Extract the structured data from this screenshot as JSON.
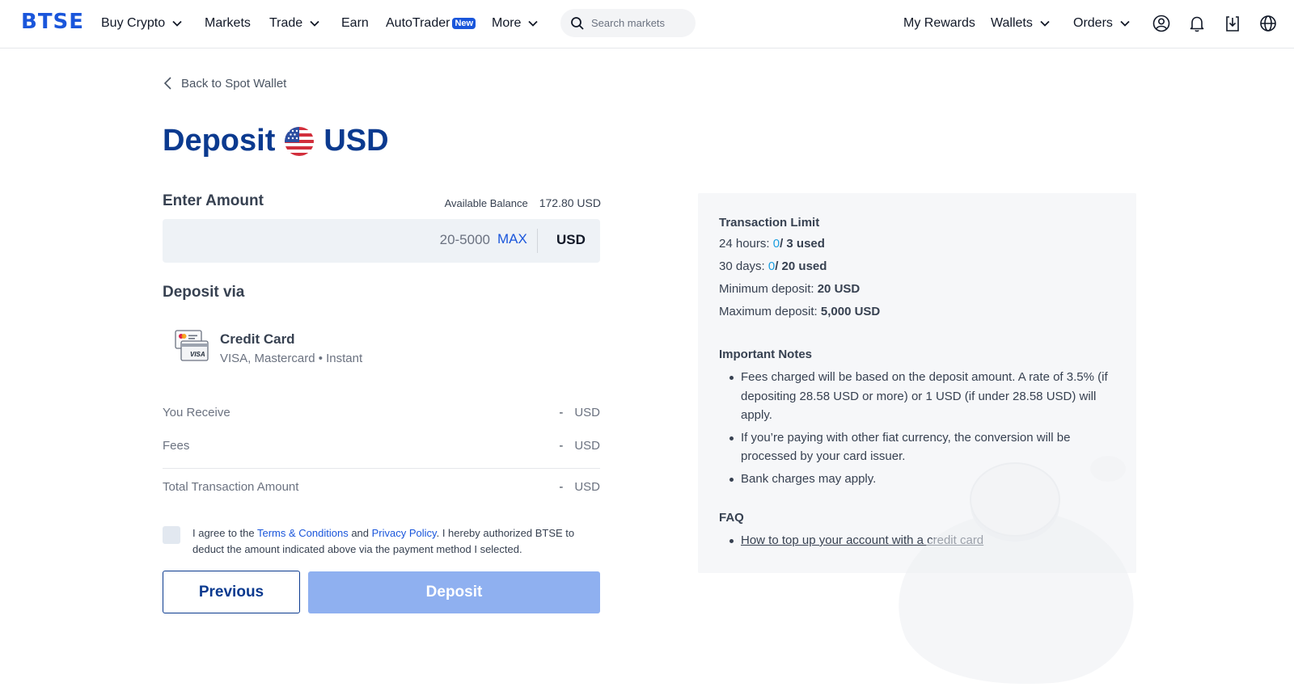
{
  "nav": {
    "logo": "BTSE",
    "items": [
      {
        "label": "Buy Crypto",
        "has_dropdown": true
      },
      {
        "label": "Markets",
        "has_dropdown": false
      },
      {
        "label": "Trade",
        "has_dropdown": true
      },
      {
        "label": "Earn",
        "has_dropdown": false
      },
      {
        "label": "AutoTrader",
        "badge": "New",
        "has_dropdown": false
      },
      {
        "label": "More",
        "has_dropdown": true
      }
    ],
    "search_placeholder": "Search markets",
    "right_items": [
      {
        "label": "My Rewards",
        "has_dropdown": false
      },
      {
        "label": "Wallets",
        "has_dropdown": true
      },
      {
        "label": "Orders",
        "has_dropdown": true
      }
    ],
    "icons": [
      "user-icon",
      "bell-icon",
      "download-icon",
      "globe-icon"
    ]
  },
  "back_link": "Back to Spot Wallet",
  "page_title": {
    "prefix": "Deposit",
    "currency": "USD",
    "flag_icon": "us-flag-icon"
  },
  "amount": {
    "label": "Enter Amount",
    "balance_label": "Available Balance",
    "balance_value": "172.80 USD",
    "placeholder": "20-5000",
    "max_label": "MAX",
    "currency": "USD"
  },
  "deposit_via": {
    "label": "Deposit via",
    "method": {
      "name": "Credit Card",
      "sub": "VISA, Mastercard • Instant",
      "icon": "credit-card-icon",
      "card_text": "VISA"
    }
  },
  "summary": [
    {
      "label": "You Receive",
      "value": "-",
      "unit": "USD"
    },
    {
      "label": "Fees",
      "value": "-",
      "unit": "USD"
    },
    {
      "label": "Total Transaction Amount",
      "value": "-",
      "unit": "USD"
    }
  ],
  "agreement": {
    "pre": "I agree to the ",
    "terms": "Terms & Conditions",
    "mid": " and ",
    "privacy": "Privacy Policy",
    "post": ". I hereby authorized BTSE to deduct the amount indicated above via the payment method I selected.",
    "checked": false
  },
  "buttons": {
    "previous": "Previous",
    "deposit": "Deposit"
  },
  "colors": {
    "brand": "#1a56db",
    "title": "#0b3a8f",
    "highlight": "#1a9ee0",
    "deposit_disabled": "#8fb0f0"
  },
  "info": {
    "limit_title": "Transaction Limit",
    "limits": [
      {
        "label": "24 hours: ",
        "used": "0",
        "rest": "/ 3 used"
      },
      {
        "label": "30 days: ",
        "used": "0",
        "rest": "/ 20 used"
      }
    ],
    "min_label": "Minimum deposit: ",
    "min_value": "20 USD",
    "max_label": "Maximum deposit: ",
    "max_value": "5,000 USD",
    "notes_title": "Important Notes",
    "notes": [
      "Fees charged will be based on the deposit amount. A rate of 3.5% (if depositing 28.58 USD or more) or 1 USD (if under 28.58 USD) will apply.",
      "If you’re paying with other fiat currency, the conversion will be processed by your card issuer.",
      "Bank charges may apply."
    ],
    "faq_title": "FAQ",
    "faq_links": [
      "How to top up your account with a credit card"
    ]
  }
}
